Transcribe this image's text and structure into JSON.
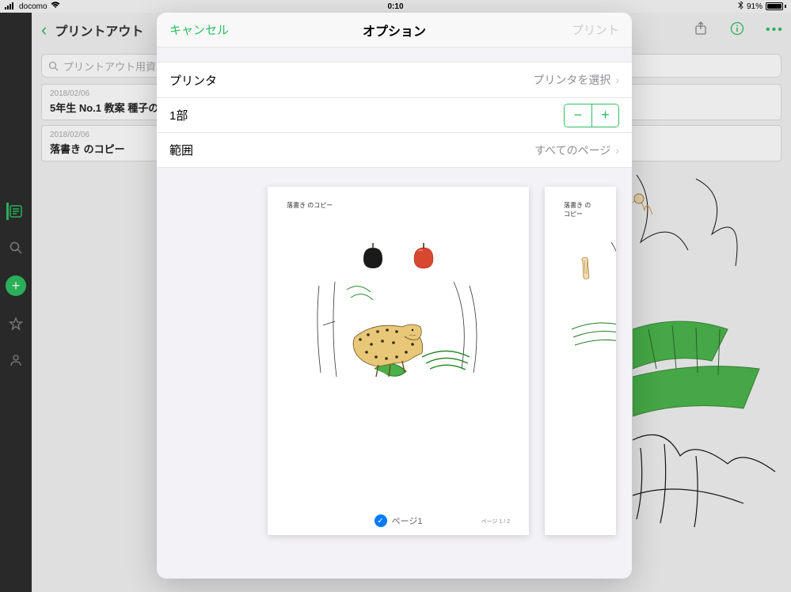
{
  "status": {
    "carrier": "docomo",
    "time": "0:10",
    "battery_pct": "91%"
  },
  "app": {
    "title_truncated": "プリントアウト",
    "search_placeholder": "プリントアウト用資料 か",
    "notes": [
      {
        "date": "2018/02/06",
        "title": "5年生 No.1 教案 種子のつく"
      },
      {
        "date": "2018/02/06",
        "title": "落書き のコピー"
      }
    ]
  },
  "modal": {
    "cancel": "キャンセル",
    "title": "オプション",
    "print": "プリント",
    "printer_label": "プリンタ",
    "printer_value": "プリンタを選択",
    "copies_label": "1部",
    "range_label": "範囲",
    "range_value": "すべてのページ",
    "preview": {
      "doc_title": "落書き のコピー",
      "page_label": "ページ1",
      "page_counter": "ページ 1 / 2"
    }
  }
}
